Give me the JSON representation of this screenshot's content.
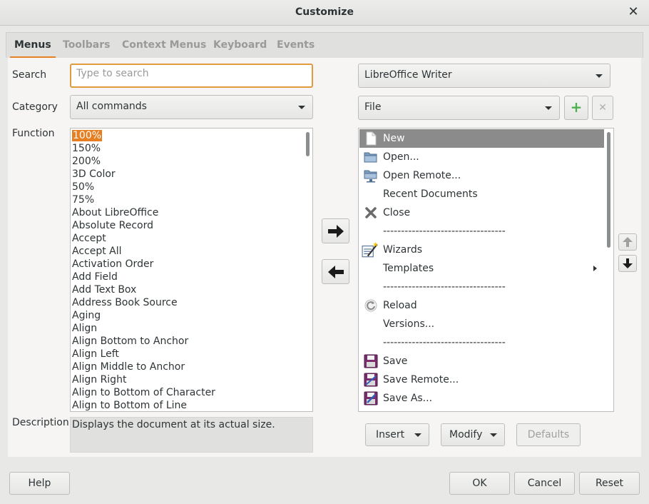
{
  "window": {
    "title": "Customize",
    "close_glyph": "✕"
  },
  "tabs": [
    {
      "label": "Menus",
      "active": true
    },
    {
      "label": "Toolbars",
      "active": false
    },
    {
      "label": "Context Menus",
      "active": false
    },
    {
      "label": "Keyboard",
      "active": false
    },
    {
      "label": "Events",
      "active": false
    }
  ],
  "left": {
    "search_label": "Search",
    "search_placeholder": "Type to search",
    "search_value": "",
    "category_label": "Category",
    "category_value": "All commands",
    "function_label": "Function",
    "functions": [
      "100%",
      "150%",
      "200%",
      "3D Color",
      "50%",
      "75%",
      "About LibreOffice",
      "Absolute Record",
      "Accept",
      "Accept All",
      "Activation Order",
      "Add Field",
      "Add Text Box",
      "Address Book Source",
      "Aging",
      "Align",
      "Align Bottom to Anchor",
      "Align Left",
      "Align Middle to Anchor",
      "Align Right",
      "Align to Bottom of Character",
      "Align to Bottom of Line"
    ],
    "selected_function": "100%",
    "description_label": "Description",
    "description_text": "Displays the document at its actual size."
  },
  "right": {
    "target_value": "LibreOffice Writer",
    "menu_value": "File",
    "add_glyph": "+",
    "remove_glyph": "✕",
    "entries": [
      {
        "label": "New",
        "icon": "new-document-icon",
        "selected": true
      },
      {
        "label": "Open...",
        "icon": "open-folder-icon"
      },
      {
        "label": "Open Remote...",
        "icon": "open-remote-icon"
      },
      {
        "label": "Recent Documents",
        "icon": ""
      },
      {
        "label": "Close",
        "icon": "close-icon"
      },
      {
        "label": "----------------------------------",
        "icon": "",
        "separator": true
      },
      {
        "label": "Wizards",
        "icon": "wizards-icon"
      },
      {
        "label": "Templates",
        "icon": "",
        "submenu": true
      },
      {
        "label": "----------------------------------",
        "icon": "",
        "separator": true
      },
      {
        "label": "Reload",
        "icon": "reload-icon"
      },
      {
        "label": "Versions...",
        "icon": ""
      },
      {
        "label": "----------------------------------",
        "icon": "",
        "separator": true
      },
      {
        "label": "Save",
        "icon": "save-icon"
      },
      {
        "label": "Save Remote...",
        "icon": "save-remote-icon"
      },
      {
        "label": "Save As...",
        "icon": "save-as-icon"
      }
    ],
    "insert_label": "Insert",
    "modify_label": "Modify",
    "defaults_label": "Defaults"
  },
  "footer": {
    "help_label": "Help",
    "ok_label": "OK",
    "cancel_label": "Cancel",
    "reset_label": "Reset"
  },
  "colors": {
    "accent": "#e67e22",
    "selection": "#8b8b8b",
    "add_icon": "#4caf50"
  }
}
